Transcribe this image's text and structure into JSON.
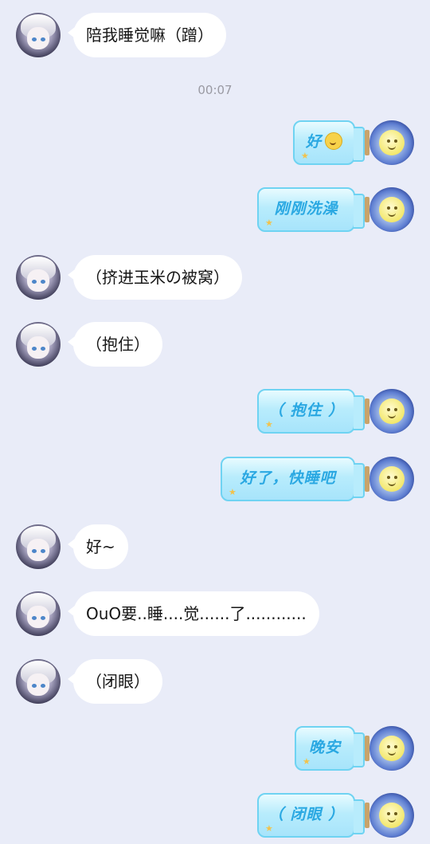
{
  "timestamp": "00:07",
  "messages": [
    {
      "side": "left",
      "text": "陪我睡觉嘛（蹭）"
    },
    {
      "side": "right",
      "text": "好",
      "emoji": "upside-down-face-emoji"
    },
    {
      "side": "right",
      "text": "刚刚洗澡"
    },
    {
      "side": "left",
      "text": "（挤进玉米の被窝）"
    },
    {
      "side": "left",
      "text": "（抱住）"
    },
    {
      "side": "right",
      "text": "（ 抱住 ）"
    },
    {
      "side": "right",
      "text": "好了，快睡吧"
    },
    {
      "side": "left",
      "text": "好~"
    },
    {
      "side": "left",
      "text": "OuO要..睡....觉......了............"
    },
    {
      "side": "left",
      "text": "（闭眼）"
    },
    {
      "side": "right",
      "text": "晚安"
    },
    {
      "side": "right",
      "text": "（ 闭眼 ）"
    }
  ],
  "colors": {
    "background": "#e9ecf8",
    "left_bubble": "#ffffff",
    "bottle_border": "#6fd3f2",
    "bottle_text": "#2aa8e2"
  }
}
